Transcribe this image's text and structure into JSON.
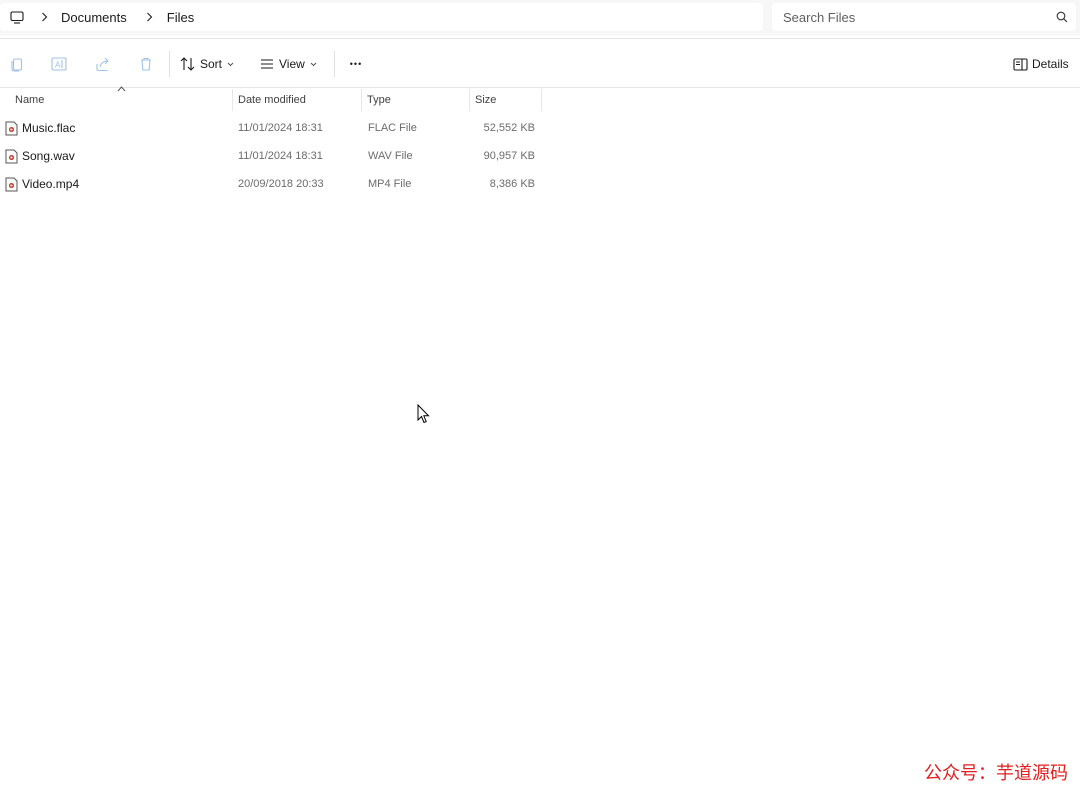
{
  "breadcrumb": {
    "items": [
      "Documents",
      "Files"
    ]
  },
  "search": {
    "placeholder": "Search Files"
  },
  "toolbar": {
    "sort_label": "Sort",
    "view_label": "View",
    "more_label": "•••",
    "details_label": "Details"
  },
  "columns": {
    "name": "Name",
    "date": "Date modified",
    "type": "Type",
    "size": "Size"
  },
  "files": [
    {
      "name": "Music.flac",
      "date": "11/01/2024 18:31",
      "type": "FLAC File",
      "size": "52,552 KB"
    },
    {
      "name": "Song.wav",
      "date": "11/01/2024 18:31",
      "type": "WAV File",
      "size": "90,957 KB"
    },
    {
      "name": "Video.mp4",
      "date": "20/09/2018 20:33",
      "type": "MP4 File",
      "size": "8,386 KB"
    }
  ],
  "watermark": "公众号：芋道源码",
  "colors": {
    "accent_disabled": "#9ec2e6",
    "watermark": "#e02020"
  }
}
